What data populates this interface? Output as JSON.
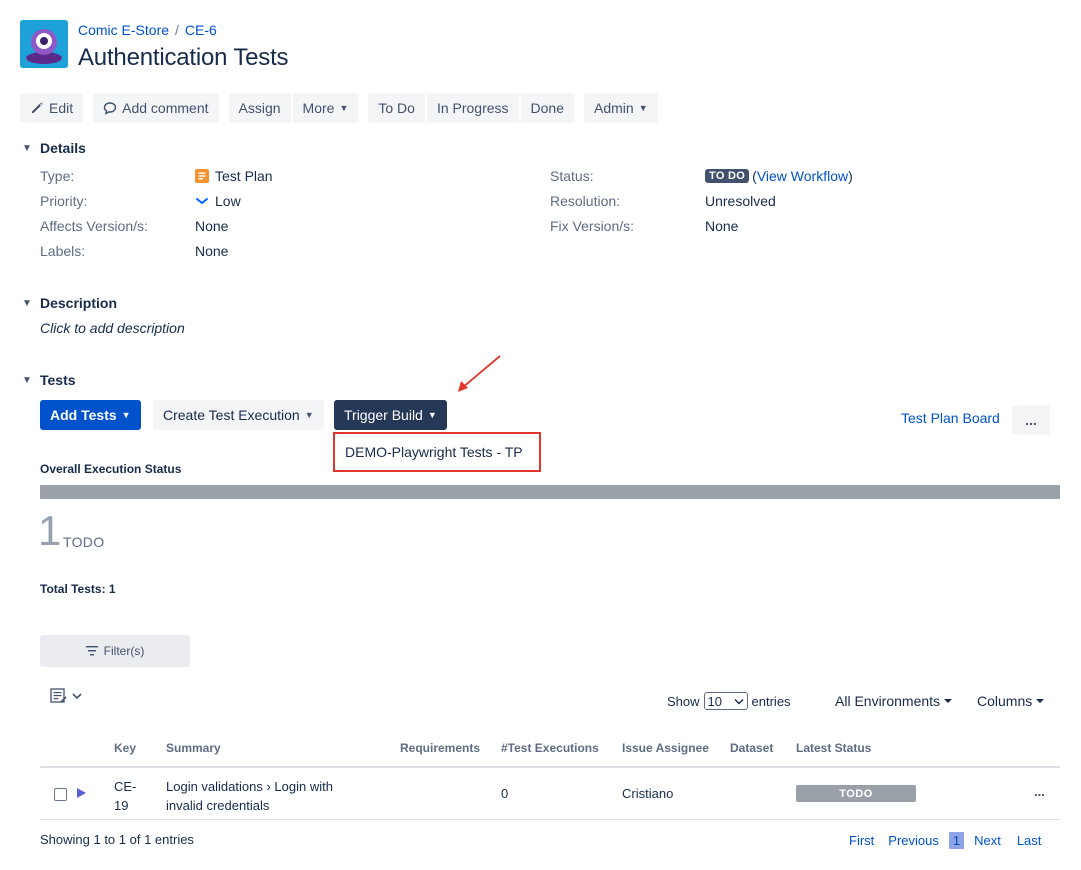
{
  "breadcrumb": {
    "project": "Comic E-Store",
    "separator": "/",
    "issue_key": "CE-6"
  },
  "title": "Authentication Tests",
  "toolbar": {
    "edit": "Edit",
    "add_comment": "Add comment",
    "assign": "Assign",
    "more": "More",
    "to_do": "To Do",
    "in_progress": "In Progress",
    "done": "Done",
    "admin": "Admin"
  },
  "details": {
    "heading": "Details",
    "type_label": "Type:",
    "type_value": "Test Plan",
    "priority_label": "Priority:",
    "priority_value": "Low",
    "affects_label": "Affects Version/s:",
    "affects_value": "None",
    "labels_label": "Labels:",
    "labels_value": "None",
    "status_label": "Status:",
    "status_value": "TO DO",
    "view_workflow_open": "(",
    "view_workflow": "View Workflow",
    "view_workflow_close": ")",
    "resolution_label": "Resolution:",
    "resolution_value": "Unresolved",
    "fix_label": "Fix Version/s:",
    "fix_value": "None"
  },
  "description": {
    "heading": "Description",
    "placeholder": "Click to add description"
  },
  "tests": {
    "heading": "Tests",
    "add_tests": "Add Tests",
    "create_execution": "Create Test Execution",
    "trigger_build": "Trigger Build",
    "dropdown_item": "DEMO-Playwright Tests - TP",
    "board_link": "Test Plan Board",
    "more_icon": "..."
  },
  "execution": {
    "label": "Overall Execution Status",
    "count": "1",
    "state": "TODO",
    "total": "Total Tests: 1"
  },
  "filters": {
    "label": "Filter(s)"
  },
  "table_controls": {
    "show": "Show",
    "entries_value": "10",
    "entries": "entries",
    "environments": "All Environments",
    "columns": "Columns"
  },
  "table": {
    "headers": {
      "key": "Key",
      "summary": "Summary",
      "requirements": "Requirements",
      "executions": "#Test Executions",
      "assignee": "Issue Assignee",
      "dataset": "Dataset",
      "latest_status": "Latest Status"
    },
    "rows": [
      {
        "key_line1": "CE-",
        "key_line2": "19",
        "summary_line1": "Login validations › Login with",
        "summary_line2": "invalid credentials",
        "executions": "0",
        "assignee": "Cristiano",
        "status": "TODO",
        "actions": "..."
      }
    ]
  },
  "footer": {
    "showing": "Showing 1 to 1 of 1 entries",
    "first": "First",
    "previous": "Previous",
    "current": "1",
    "next": "Next",
    "last": "Last"
  },
  "colors": {
    "accent": "#0052cc",
    "dark_button": "#253858",
    "highlight": "#e1362b",
    "status_gray": "#9aa0a8"
  }
}
